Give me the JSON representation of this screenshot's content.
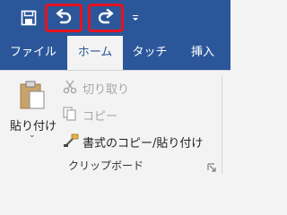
{
  "quick_access": {
    "save_icon": "save-icon",
    "undo_icon": "undo-icon",
    "redo_icon": "redo-icon",
    "customize_icon": "customize-qat-icon"
  },
  "tabs": [
    {
      "label": "ファイル"
    },
    {
      "label": "ホーム"
    },
    {
      "label": "タッチ"
    },
    {
      "label": "挿入"
    }
  ],
  "clipboard": {
    "paste_label_line1": "貼り付け",
    "cut_label": "切り取り",
    "copy_label": "コピー",
    "format_painter_label": "書式のコピー/貼り付け",
    "group_label": "クリップボード"
  },
  "colors": {
    "brand": "#2b579a",
    "highlight": "#e8121e"
  }
}
